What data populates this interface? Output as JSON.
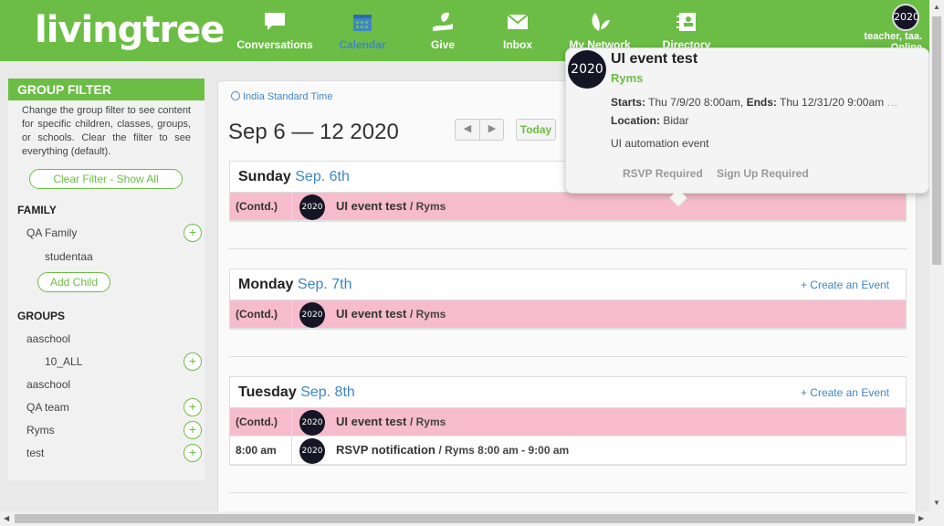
{
  "app": {
    "logo_text": "livingtree"
  },
  "nav": {
    "items": [
      {
        "label": "Conversations",
        "icon": "chat-icon"
      },
      {
        "label": "Calendar",
        "icon": "calendar-icon"
      },
      {
        "label": "Give",
        "icon": "give-icon"
      },
      {
        "label": "Inbox",
        "icon": "mail-icon"
      },
      {
        "label": "My Network",
        "icon": "network-icon"
      },
      {
        "label": "Directory",
        "icon": "directory-icon"
      }
    ],
    "active": "Calendar",
    "user_name": "teacher, taa.",
    "user_sub": "Online",
    "avatar_text": "2020"
  },
  "sidebar": {
    "title": "GROUP FILTER",
    "description": "Change the group filter to see content for specific children, classes, groups, or schools. Clear the filter to see everything (default).",
    "clear_filter": "Clear Filter - Show All",
    "family_heading": "FAMILY",
    "family": [
      {
        "label": "QA Family"
      },
      {
        "label": "studentaa"
      }
    ],
    "add_child": "Add Child",
    "groups_heading": "GROUPS",
    "groups": [
      {
        "label": "aaschool"
      },
      {
        "label": "10_ALL"
      },
      {
        "label": "aaschool"
      },
      {
        "label": "QA team"
      },
      {
        "label": "Ryms"
      },
      {
        "label": "test"
      }
    ]
  },
  "calendar": {
    "timezone": "India Standard Time",
    "date_range": "Sep 6 — 12 2020",
    "prev": "◀",
    "next": "▶",
    "today": "Today",
    "create_event": "+ Create an Event",
    "days": [
      {
        "name": "Sunday",
        "date": "Sep. 6th",
        "events": [
          {
            "time": "(Contd.)",
            "title": "UI event test",
            "group": "/ Ryms"
          }
        ]
      },
      {
        "name": "Monday",
        "date": "Sep. 7th",
        "events": [
          {
            "time": "(Contd.)",
            "title": "UI event test",
            "group": "/ Ryms"
          }
        ]
      },
      {
        "name": "Tuesday",
        "date": "Sep. 8th",
        "events": [
          {
            "time": "(Contd.)",
            "title": "UI event test",
            "group": "/ Ryms"
          },
          {
            "time": "8:00 am",
            "title": "RSVP notification",
            "group": "/ Ryms 8:00 am - 9:00 am"
          }
        ]
      }
    ]
  },
  "popover": {
    "title": "UI event test",
    "group": "Ryms",
    "starts_label": "Starts:",
    "starts_value": "Thu 7/9/20 8:00am,",
    "ends_label": "Ends:",
    "ends_value": "Thu 12/31/20 9:00am",
    "ellipsis": "…",
    "location_label": "Location:",
    "location_value": "Bidar",
    "description": "UI automation event",
    "rsvp_required": "RSVP Required",
    "signup_required": "Sign Up Required"
  },
  "colors": {
    "brand": "#6cbd45",
    "link": "#3f86c8",
    "contd_row": "#f6bccd"
  }
}
